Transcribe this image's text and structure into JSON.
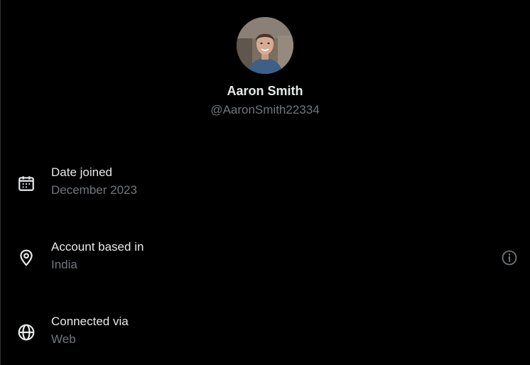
{
  "profile": {
    "name": "Aaron Smith",
    "handle": "@AaronSmith22334"
  },
  "details": [
    {
      "icon": "calendar-icon",
      "label": "Date joined",
      "value": "December 2023"
    },
    {
      "icon": "location-pin-icon",
      "label": "Account based in",
      "value": "India"
    },
    {
      "icon": "globe-icon",
      "label": "Connected via",
      "value": "Web"
    }
  ],
  "colors": {
    "background": "#000000",
    "primary_text": "#e7e9ea",
    "secondary_text": "#71767b",
    "icon": "#e7e9ea",
    "info_icon": "#71767b"
  }
}
